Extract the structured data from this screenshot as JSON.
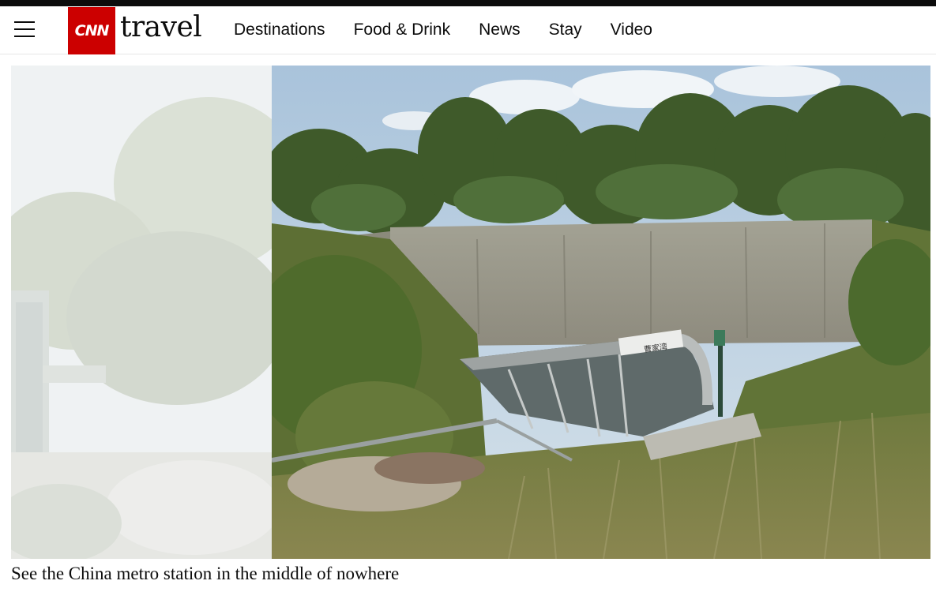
{
  "header": {
    "logo_mark": "CNN",
    "logo_word": "travel",
    "nav": [
      {
        "label": "Destinations"
      },
      {
        "label": "Food & Drink"
      },
      {
        "label": "News"
      },
      {
        "label": "Stay"
      },
      {
        "label": "Video"
      }
    ]
  },
  "gallery": {
    "caption": "See the China metro station in the middle of nowhere",
    "station_sign": "曹家湾"
  },
  "colors": {
    "brand_red": "#cc0000",
    "text": "#0c0c0c"
  }
}
